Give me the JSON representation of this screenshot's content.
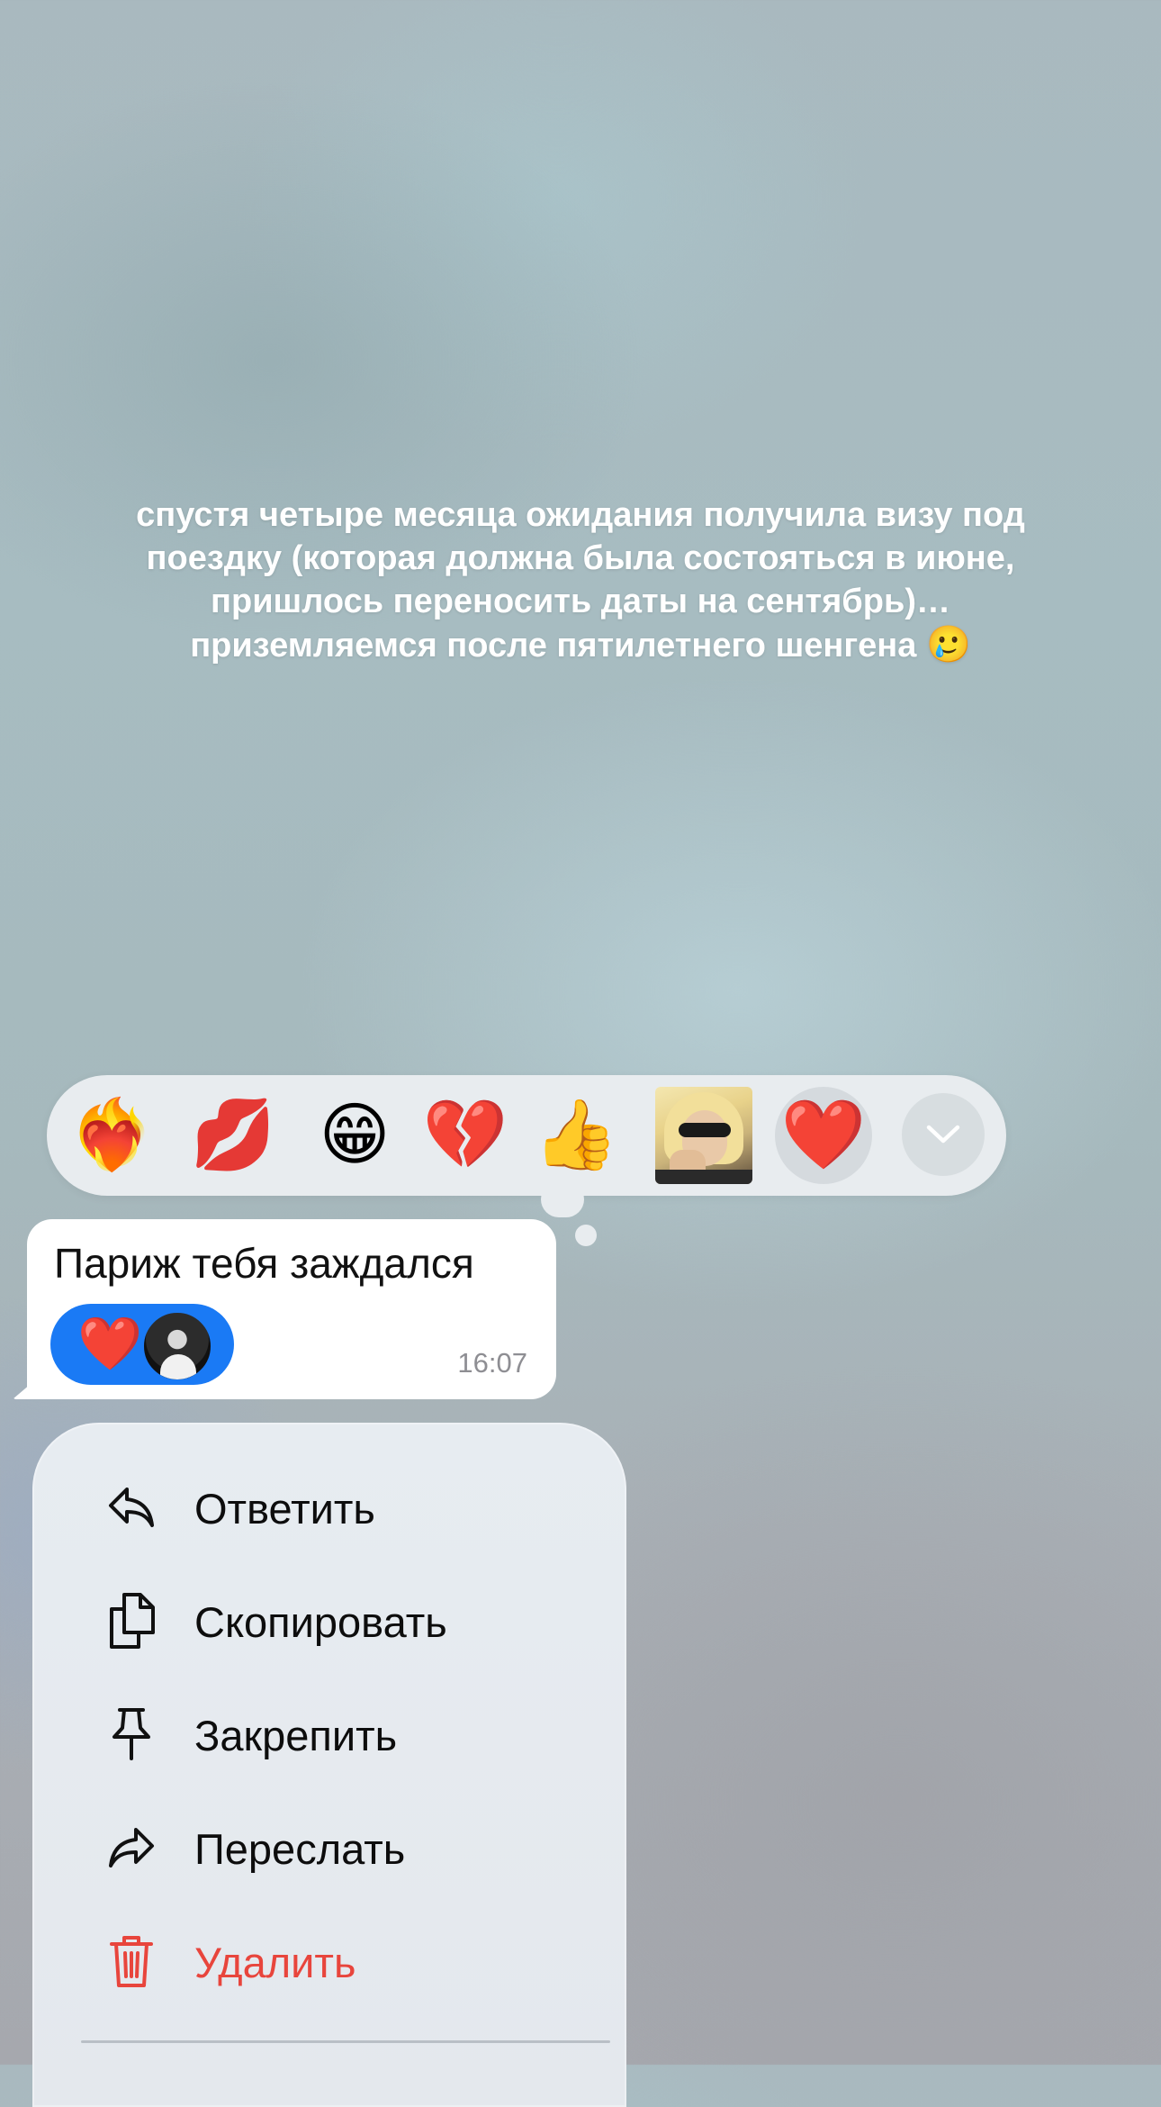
{
  "story": {
    "caption": "спустя четыре месяца ожидания получила визу под\nпоездку (которая должна была состояться в июне,\nпришлось переносить даты на сентябрь)…\nприземляемся после пятилетнего шенгена",
    "caption_emoji": "🥲"
  },
  "reactions": {
    "items": [
      {
        "name": "heart-on-fire",
        "emoji": "❤️‍🔥"
      },
      {
        "name": "kiss-mark",
        "emoji": "💋"
      },
      {
        "name": "grinning-face",
        "emoji": "😁"
      },
      {
        "name": "broken-heart",
        "emoji": "💔"
      },
      {
        "name": "thumbs-up",
        "emoji": "👍"
      },
      {
        "name": "custom-photo-sticker",
        "emoji": ""
      },
      {
        "name": "red-heart",
        "emoji": "❤️",
        "selected": true
      }
    ],
    "expand_icon": "chevron-down-icon"
  },
  "message": {
    "text": "Париж тебя заждался",
    "reaction_emoji": "❤️",
    "time": "16:07"
  },
  "menu": {
    "items": [
      {
        "label": "Ответить",
        "icon": "reply-icon"
      },
      {
        "label": "Скопировать",
        "icon": "copy-icon"
      },
      {
        "label": "Закрепить",
        "icon": "pin-icon"
      },
      {
        "label": "Переслать",
        "icon": "forward-icon"
      },
      {
        "label": "Удалить",
        "icon": "trash-icon",
        "danger": true
      }
    ]
  },
  "colors": {
    "accent": "#1a7af5",
    "danger": "#e8453c",
    "menu_bg": "#e7ecf1",
    "bubble_bg": "#ffffff"
  }
}
